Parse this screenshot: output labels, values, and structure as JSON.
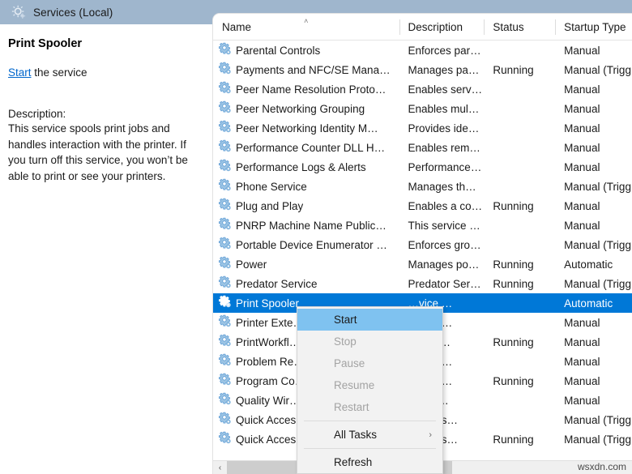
{
  "titlebar": {
    "icon": "services-gear-icon",
    "title": "Services (Local)"
  },
  "details": {
    "service_name": "Print Spooler",
    "action_link": "Start",
    "action_suffix": " the service",
    "description_label": "Description:",
    "description": "This service spools print jobs and handles interaction with the printer. If you turn off this service, you won’t be able to print or see your printers."
  },
  "list": {
    "columns": [
      {
        "label": "Name",
        "sorted": "ascending",
        "caret": "˄"
      },
      {
        "label": "Description"
      },
      {
        "label": "Status"
      },
      {
        "label": "Startup Type"
      }
    ],
    "rows": [
      {
        "name": "Parental Controls",
        "description": "Enforces par…",
        "status": "",
        "startup": "Manual"
      },
      {
        "name": "Payments and NFC/SE Mana…",
        "description": "Manages pa…",
        "status": "Running",
        "startup": "Manual (Trigg…"
      },
      {
        "name": "Peer Name Resolution Proto…",
        "description": "Enables serv…",
        "status": "",
        "startup": "Manual"
      },
      {
        "name": "Peer Networking Grouping",
        "description": "Enables mul…",
        "status": "",
        "startup": "Manual"
      },
      {
        "name": "Peer Networking Identity M…",
        "description": "Provides ide…",
        "status": "",
        "startup": "Manual"
      },
      {
        "name": "Performance Counter DLL H…",
        "description": "Enables rem…",
        "status": "",
        "startup": "Manual"
      },
      {
        "name": "Performance Logs & Alerts",
        "description": "Performance…",
        "status": "",
        "startup": "Manual"
      },
      {
        "name": "Phone Service",
        "description": "Manages th…",
        "status": "",
        "startup": "Manual (Trigg…"
      },
      {
        "name": "Plug and Play",
        "description": "Enables a co…",
        "status": "Running",
        "startup": "Manual"
      },
      {
        "name": "PNRP Machine Name Public…",
        "description": "This service …",
        "status": "",
        "startup": "Manual"
      },
      {
        "name": "Portable Device Enumerator …",
        "description": "Enforces gro…",
        "status": "",
        "startup": "Manual (Trigg…"
      },
      {
        "name": "Power",
        "description": "Manages po…",
        "status": "Running",
        "startup": "Automatic"
      },
      {
        "name": "Predator Service",
        "description": "Predator Ser…",
        "status": "Running",
        "startup": "Manual (Trigg…"
      },
      {
        "name": "Print Spooler",
        "description": "…vice …",
        "status": "",
        "startup": "Automatic",
        "selected": true
      },
      {
        "name": "Printer Exte…",
        "description": "…vice …",
        "status": "",
        "startup": "Manual"
      },
      {
        "name": "PrintWorkfl…",
        "description": "…orkfl…",
        "status": "Running",
        "startup": "Manual"
      },
      {
        "name": "Problem Re…",
        "description": "…vice …",
        "status": "",
        "startup": "Manual"
      },
      {
        "name": "Program Co…",
        "description": "…vice …",
        "status": "Running",
        "startup": "Manual"
      },
      {
        "name": "Quality Wir…",
        "description": "…Win…",
        "status": "",
        "startup": "Manual"
      },
      {
        "name": "Quick Acces…",
        "description": "…ccess…",
        "status": "",
        "startup": "Manual (Trigg…"
      },
      {
        "name": "Quick Acces…",
        "description": "…ccess…",
        "status": "Running",
        "startup": "Manual (Trigg…"
      }
    ],
    "hscroll": {
      "left_arrow": "‹"
    }
  },
  "context_menu": {
    "items": [
      {
        "label": "Start",
        "state": "highlighted"
      },
      {
        "label": "Stop",
        "state": "disabled"
      },
      {
        "label": "Pause",
        "state": "disabled"
      },
      {
        "label": "Resume",
        "state": "disabled"
      },
      {
        "label": "Restart",
        "state": "disabled"
      },
      {
        "separator": true
      },
      {
        "label": "All Tasks",
        "state": "enabled",
        "submenu": true,
        "arrow": "›"
      },
      {
        "separator": true
      },
      {
        "label": "Refresh",
        "state": "enabled"
      }
    ]
  },
  "watermark": "wsxdn.com",
  "colors": {
    "titlebar": "#9fb6cd",
    "selection": "#0078d7",
    "menu_highlight": "#7fc2f0",
    "link": "#0066cc",
    "menu_bg": "#f2f2f2"
  }
}
